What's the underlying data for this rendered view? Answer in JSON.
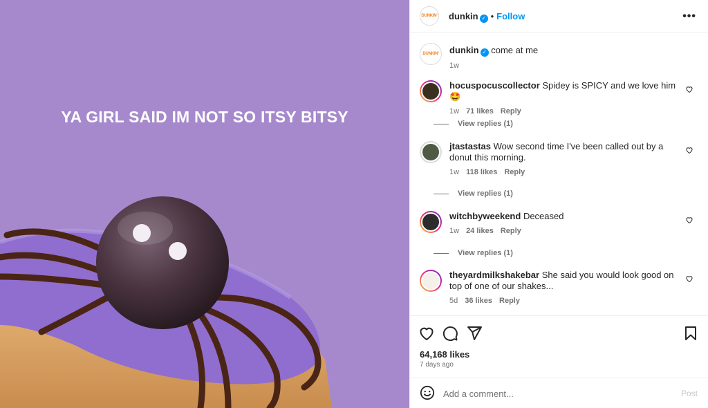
{
  "post": {
    "headline": "YA GIRL SAID IM NOT SO ITSY BITSY",
    "background": "#a689cd"
  },
  "header": {
    "avatar_text": "DUNKIN'",
    "username": "dunkin",
    "verified_icon": "verified-badge-icon",
    "separator": "•",
    "follow_label": "Follow",
    "more_icon": "more-options-icon"
  },
  "caption": {
    "username": "dunkin",
    "text": "come at me",
    "time": "1w"
  },
  "comments": [
    {
      "username": "hocuspocuscollector",
      "text": "Spidey is SPICY and we love him 🤩",
      "time": "1w",
      "likes": "71 likes",
      "reply": "Reply",
      "view_replies": "View replies (1)"
    },
    {
      "username": "jtastastas",
      "text": "Wow second time I've been called out by a donut this morning.",
      "time": "1w",
      "likes": "118 likes",
      "reply": "Reply",
      "view_replies": "View replies (1)"
    },
    {
      "username": "witchbyweekend",
      "text": "Deceased",
      "time": "1w",
      "likes": "24 likes",
      "reply": "Reply",
      "view_replies": "View replies (1)"
    },
    {
      "username": "theyardmilkshakebar",
      "text": "She said you would look good on top of one of our shakes...",
      "time": "5d",
      "likes": "36 likes",
      "reply": "Reply"
    }
  ],
  "actions": {
    "like_icon": "heart-icon",
    "comment_icon": "comment-icon",
    "share_icon": "share-icon",
    "save_icon": "bookmark-icon",
    "likes_count": "64,168 likes",
    "posted": "7 days ago"
  },
  "add_comment": {
    "placeholder": "Add a comment...",
    "post_label": "Post"
  },
  "colors": {
    "accent": "#0095f6",
    "muted": "#737373",
    "border": "#efefef"
  }
}
